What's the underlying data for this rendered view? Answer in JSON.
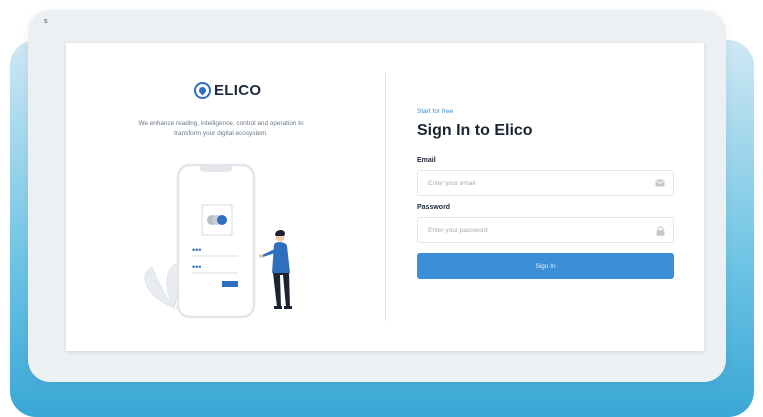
{
  "corner_mark": "s",
  "brand": {
    "logo_text": "ELICO",
    "tagline": "We enhance reading, intelligence, control and operation to transform your digital ecosystem."
  },
  "form": {
    "kicker": "Start for free",
    "title": "Sign In to Elico",
    "email_label": "Email",
    "email_placeholder": "Enter your email",
    "email_value": "",
    "password_label": "Password",
    "password_placeholder": "Enter your password",
    "password_value": "",
    "submit_label": "Sign In"
  },
  "illustration": {
    "pin_dots_1": "•••",
    "pin_dots_2": "•••"
  },
  "icons": {
    "email": "envelope-icon",
    "password": "lock-icon",
    "logo": "elico-logo-icon"
  },
  "colors": {
    "accent": "#3b8fd8",
    "brand": "#2f6fbd",
    "background_gradient_end": "#3aa7d6"
  }
}
